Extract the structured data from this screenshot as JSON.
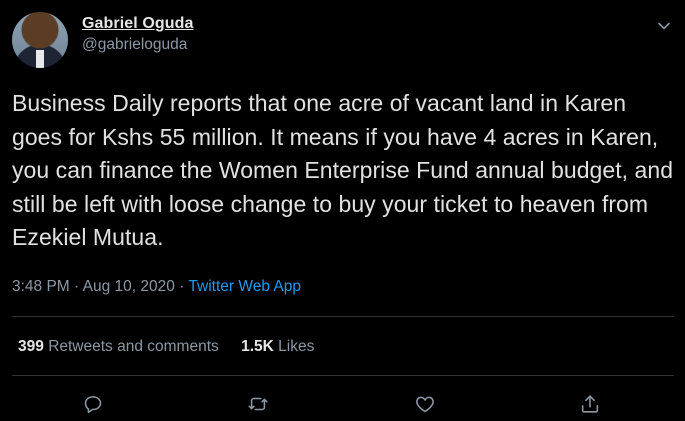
{
  "user": {
    "display_name": "Gabriel Oguda",
    "handle": "@gabrieloguda"
  },
  "tweet": {
    "text": "Business Daily reports that one acre of vacant land in Karen goes for Kshs 55 million. It means if you have 4 acres in Karen, you can finance the Women Enterprise Fund annual budget, and still be left with loose change to buy your ticket to heaven from Ezekiel Mutua.",
    "time": "3:48 PM",
    "separator": "·",
    "date": "Aug 10, 2020",
    "source": "Twitter Web App"
  },
  "stats": {
    "retweets_count": "399",
    "retweets_label": "Retweets and comments",
    "likes_count": "1.5K",
    "likes_label": "Likes"
  },
  "icons": {
    "caret": "chevron-down-icon",
    "reply": "reply-icon",
    "retweet": "retweet-icon",
    "like": "heart-icon",
    "share": "share-icon"
  },
  "colors": {
    "background": "#000000",
    "text": "#e1e1e1",
    "secondary": "#8b98a5",
    "link": "#1d9bf0",
    "divider": "#2f3336"
  }
}
